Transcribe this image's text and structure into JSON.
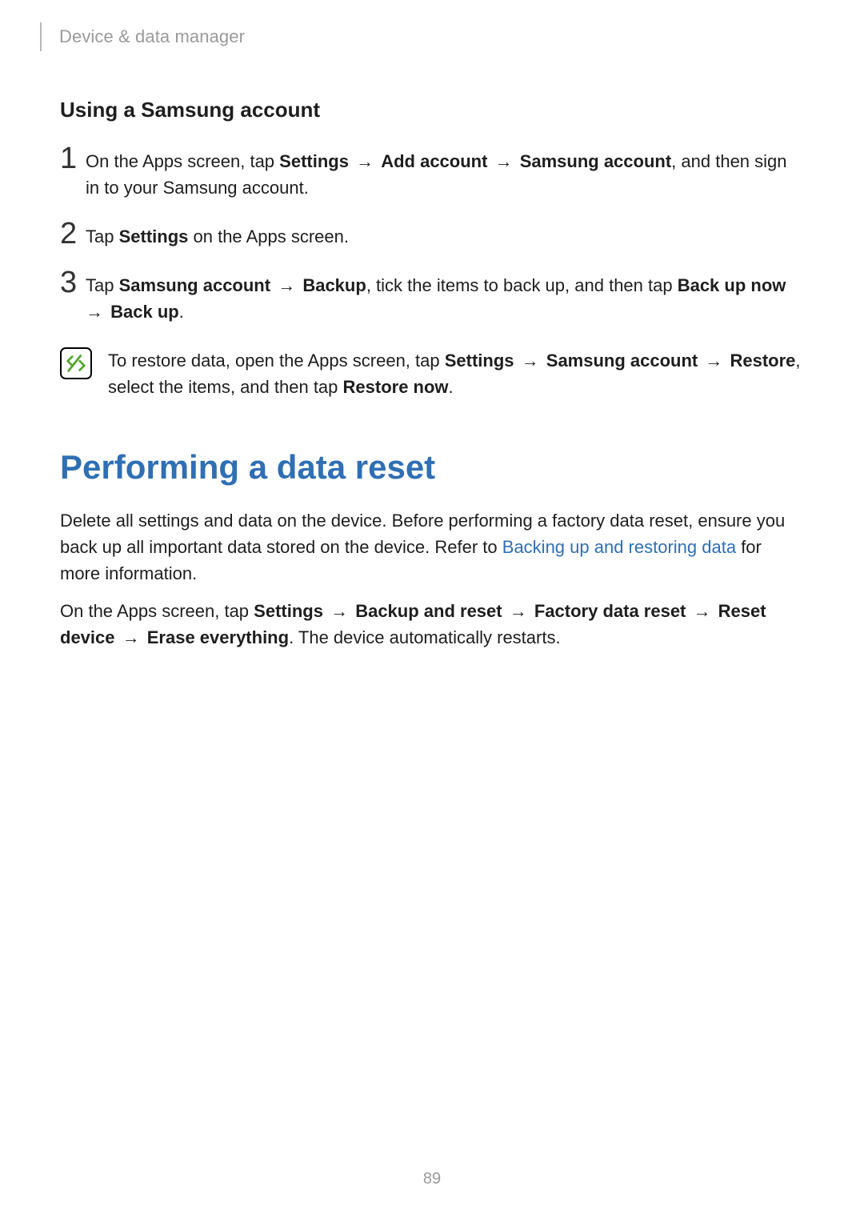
{
  "header": {
    "breadcrumb": "Device & data manager"
  },
  "section1": {
    "subhead": "Using a Samsung account",
    "steps": [
      {
        "num": "1",
        "pre": "On the Apps screen, tap ",
        "b1": "Settings",
        "b2": "Add account",
        "b3": "Samsung account",
        "post": ", and then sign in to your Samsung account."
      },
      {
        "num": "2",
        "pre": "Tap ",
        "b1": "Settings",
        "post": " on the Apps screen."
      },
      {
        "num": "3",
        "pre": "Tap ",
        "b1": "Samsung account",
        "b2": "Backup",
        "mid": ", tick the items to back up, and then tap ",
        "b3": "Back up now",
        "b4": "Back up",
        "post": "."
      }
    ],
    "note": {
      "pre": "To restore data, open the Apps screen, tap ",
      "b1": "Settings",
      "b2": "Samsung account",
      "b3": "Restore",
      "mid": ", select the items, and then tap ",
      "b4": "Restore now",
      "post": "."
    }
  },
  "section2": {
    "title": "Performing a data reset",
    "p1_a": "Delete all settings and data on the device. Before performing a factory data reset, ensure you back up all important data stored on the device. Refer to ",
    "p1_link": "Backing up and restoring data",
    "p1_b": " for more information.",
    "p2_pre": "On the Apps screen, tap ",
    "p2_b1": "Settings",
    "p2_b2": "Backup and reset",
    "p2_b3": "Factory data reset",
    "p2_b4": "Reset device",
    "p2_b5": "Erase everything",
    "p2_post": ". The device automatically restarts."
  },
  "arrow": "→",
  "page_number": "89"
}
